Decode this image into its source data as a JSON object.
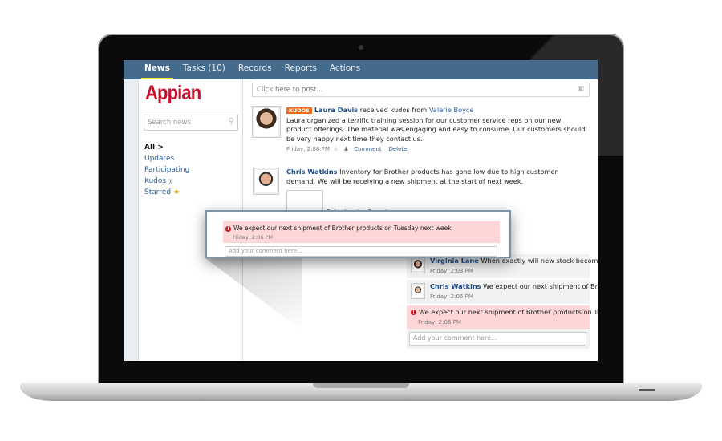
{
  "nav": {
    "items": [
      "News",
      "Tasks (10)",
      "Records",
      "Reports",
      "Actions"
    ],
    "active": "News"
  },
  "brand": {
    "logo": "Appian",
    "color": "#c8102e",
    "nav_color": "#456b8c"
  },
  "sidebar": {
    "search_placeholder": "Search news",
    "links": [
      "All >",
      "Updates",
      "Participating",
      "Kudos",
      "Starred"
    ]
  },
  "composer": {
    "placeholder": "Click here to post..."
  },
  "posts": [
    {
      "badge": "KUDOS",
      "author": "Laura Davis",
      "action": "received kudos from",
      "target": "Valerie Boyce",
      "body": "Laura organized a terrific training session for our customer service reps on our new product offerings. The material was engaging and easy to consume. Our customers should be very happy next time they contact us.",
      "time": "Friday, 2:08 PM",
      "comment_label": "Comment",
      "delete_label": "Delete"
    },
    {
      "author": "Chris Watkins",
      "body": "Inventory for Brother products has gone low due to high customer demand.  We will be receiving a new shipment at the start of next week.",
      "attachment": "Sales Invoice Report",
      "comments": [
        {
          "author": "Virginia Lane",
          "text": "When exactly will new stock become available for customer orders?",
          "time": "Friday, 2:03 PM"
        },
        {
          "author": "Chris Watkins",
          "text": "We expect our next shipment of Brother products on Tuesday next week",
          "time": "Friday, 2:06 PM"
        },
        {
          "error": true,
          "text": "We expect our next shipment of Brother products on Tuesday next week",
          "time": "Friday, 2:06 PM"
        }
      ],
      "comment_placeholder": "Add your comment here..."
    }
  ],
  "callout": {
    "text": "We expect our next shipment of Brother products on Tuesday next week",
    "time": "Friday, 2:06 PM",
    "placeholder": "Add your comment here..."
  }
}
